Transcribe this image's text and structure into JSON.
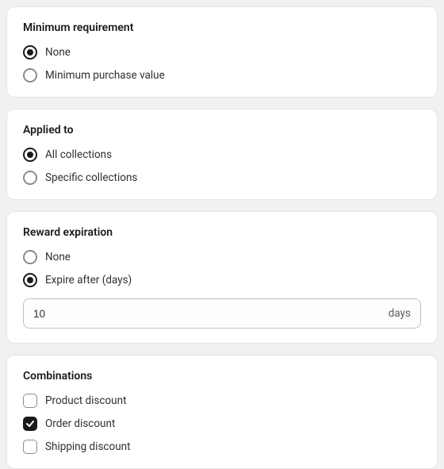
{
  "sections": {
    "minRequirement": {
      "title": "Minimum requirement",
      "options": {
        "none": "None",
        "minPurchaseValue": "Minimum purchase value"
      },
      "selected": "none"
    },
    "appliedTo": {
      "title": "Applied to",
      "options": {
        "all": "All collections",
        "specific": "Specific collections"
      },
      "selected": "all"
    },
    "rewardExpiration": {
      "title": "Reward expiration",
      "options": {
        "none": "None",
        "expireAfter": "Expire after (days)"
      },
      "selected": "expireAfter",
      "input": {
        "value": "10",
        "suffix": "days"
      }
    },
    "combinations": {
      "title": "Combinations",
      "options": {
        "product": {
          "label": "Product discount",
          "checked": false
        },
        "order": {
          "label": "Order discount",
          "checked": true
        },
        "shipping": {
          "label": "Shipping discount",
          "checked": false
        }
      }
    }
  }
}
